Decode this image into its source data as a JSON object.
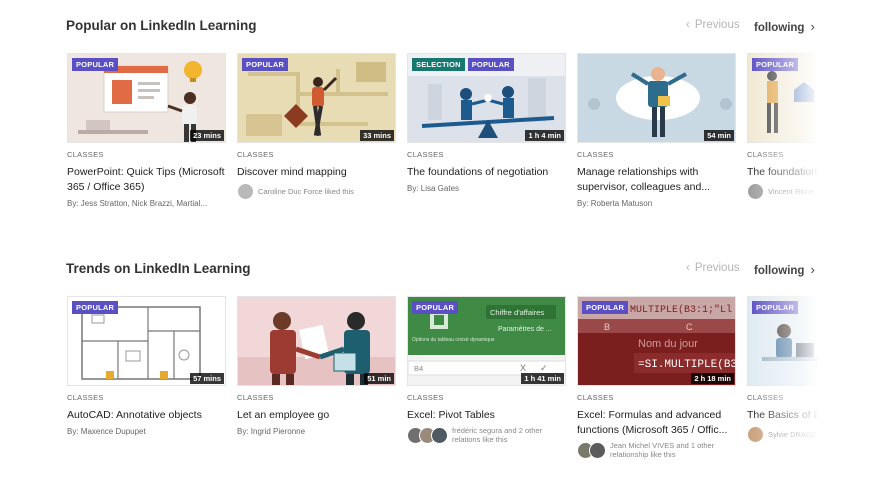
{
  "sections": [
    {
      "title": "Popular on LinkedIn Learning",
      "prev_label": "Previous",
      "next_label": "following",
      "cards": [
        {
          "badges": [
            "POPULAR"
          ],
          "duration": "23 mins",
          "type": "CLASSES",
          "title": "PowerPoint: Quick Tips (Microsoft 365 / Office 365)",
          "author": "By: Jess Stratton, Nick Brazzi, Martial..."
        },
        {
          "badges": [
            "POPULAR"
          ],
          "duration": "33 mins",
          "type": "CLASSES",
          "title": "Discover mind mapping",
          "liked": "Caroline Duc Force liked this"
        },
        {
          "badges": [
            "SELECTION",
            "POPULAR"
          ],
          "duration": "1 h 4 min",
          "type": "CLASSES",
          "title": "The foundations of negotiation",
          "author": "By: Lisa Gates"
        },
        {
          "badges": [],
          "duration": "54 min",
          "type": "CLASSES",
          "title": "Manage relationships with supervisor, colleagues and...",
          "author": "By: Roberta Matuson"
        },
        {
          "badges": [
            "POPULAR"
          ],
          "duration": "",
          "type": "CLASSES",
          "title": "The foundations of transformation",
          "liked": "Vincent Ricne"
        }
      ]
    },
    {
      "title": "Trends on LinkedIn Learning",
      "prev_label": "Previous",
      "next_label": "following",
      "cards": [
        {
          "badges": [
            "POPULAR"
          ],
          "duration": "57 mins",
          "type": "CLASSES",
          "title": "AutoCAD: Annotative objects",
          "author": "By: Maxence Dupupet"
        },
        {
          "badges": [],
          "duration": "51 min",
          "type": "CLASSES",
          "title": "Let an employee go",
          "author": "By: Ingrid Pieronne"
        },
        {
          "badges": [
            "POPULAR"
          ],
          "duration": "1 h 41 min",
          "type": "CLASSES",
          "title": "Excel: Pivot Tables",
          "liked": "frédéric segura and 2 other relations like this"
        },
        {
          "badges": [
            "POPULAR"
          ],
          "duration": "2 h 18 min",
          "type": "CLASSES",
          "title": "Excel: Formulas and advanced functions (Microsoft 365 / Offic...",
          "liked": "Jean Michel VIVES and 1 other relationship like this"
        },
        {
          "badges": [
            "POPULAR"
          ],
          "duration": "",
          "type": "CLASSES",
          "title": "The Basics of B Writing emails",
          "liked": "Sylvie DRAGE"
        }
      ]
    }
  ],
  "thumb_text": {
    "pivot_menu_1": "Chiffre d'affaires",
    "pivot_menu_2": "Paramètres de ...",
    "pivot_menu_3": "Options du tableau croisé dynamique",
    "pivot_cell": "B4",
    "formula_top": "MULTIPLE(B3:1;\"Ll",
    "formula_col_b": "B",
    "formula_col_c": "C",
    "formula_day": "Nom du jour",
    "formula_main": "=SI.MULTIPLE(B3"
  },
  "colors": {
    "popular": "#5b4fc4",
    "selection": "#16786f"
  }
}
